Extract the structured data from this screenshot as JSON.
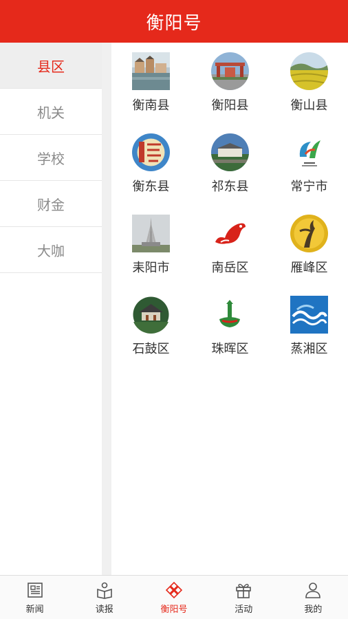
{
  "header": {
    "title": "衡阳号"
  },
  "sidebar": {
    "items": [
      {
        "label": "县区"
      },
      {
        "label": "机关"
      },
      {
        "label": "学校"
      },
      {
        "label": "财金"
      },
      {
        "label": "大咖"
      }
    ]
  },
  "grid": {
    "items": [
      {
        "label": "衡南县",
        "icon": "town-water-photo-icon"
      },
      {
        "label": "衡阳县",
        "icon": "gate-photo-icon"
      },
      {
        "label": "衡山县",
        "icon": "field-photo-icon"
      },
      {
        "label": "衡东县",
        "icon": "calligraphy-emblem-icon"
      },
      {
        "label": "祁东县",
        "icon": "building-photo-icon"
      },
      {
        "label": "常宁市",
        "icon": "changning-logo-icon"
      },
      {
        "label": "耒阳市",
        "icon": "monument-photo-icon"
      },
      {
        "label": "南岳区",
        "icon": "red-bird-logo-icon"
      },
      {
        "label": "雁峰区",
        "icon": "goose-emblem-icon"
      },
      {
        "label": "石鼓区",
        "icon": "pavilion-photo-icon"
      },
      {
        "label": "珠晖区",
        "icon": "tower-logo-icon"
      },
      {
        "label": "蒸湘区",
        "icon": "wave-logo-icon"
      }
    ]
  },
  "tabbar": {
    "items": [
      {
        "label": "新闻"
      },
      {
        "label": "读报"
      },
      {
        "label": "衡阳号"
      },
      {
        "label": "活动"
      },
      {
        "label": "我的"
      }
    ]
  },
  "colors": {
    "accent": "#e5291b",
    "text": "#333333",
    "muted": "#8a8a8a"
  }
}
